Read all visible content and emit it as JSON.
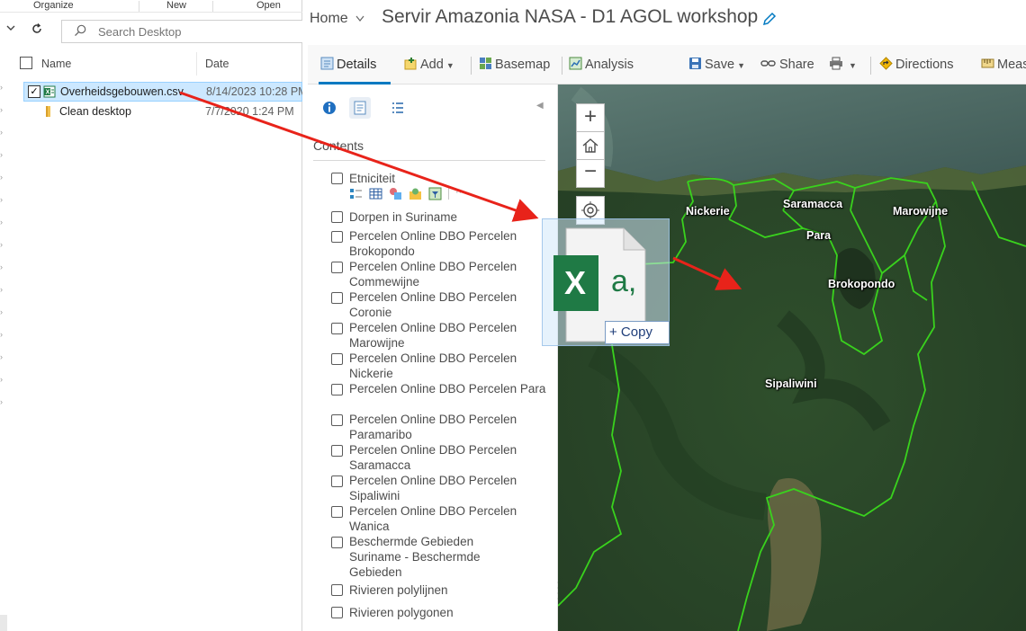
{
  "explorer": {
    "ribbon": [
      "Organize",
      "New",
      "Open"
    ],
    "search": {
      "placeholder": "Search Desktop"
    },
    "columns": {
      "name": "Name",
      "date": "Date"
    },
    "files": [
      {
        "name": "Overheidsgebouwen.csv",
        "date": "8/14/2023 10:28 PM",
        "type": "excel-csv",
        "selected": true,
        "checked": true
      },
      {
        "name": "Clean desktop",
        "date": "7/7/2020 1:24 PM",
        "type": "shortcut",
        "selected": false,
        "checked": false
      }
    ]
  },
  "arcgis": {
    "home": "Home",
    "title": "Servir Amazonia NASA - D1 AGOL workshop",
    "toolbar": {
      "details": "Details",
      "add": "Add",
      "basemap": "Basemap",
      "analysis": "Analysis",
      "save": "Save",
      "share": "Share",
      "directions": "Directions",
      "measure": "Meas"
    },
    "contents_heading": "Contents",
    "layers": [
      "Etniciteit",
      "Dorpen in Suriname",
      "Percelen Online DBO Percelen Brokopondo",
      "Percelen Online DBO Percelen Commewijne",
      "Percelen Online DBO Percelen Coronie",
      "Percelen Online DBO Percelen Marowijne",
      "Percelen Online DBO Percelen Nickerie",
      "Percelen Online DBO Percelen Para",
      "Percelen Online DBO Percelen Paramaribo",
      "Percelen Online DBO Percelen Saramacca",
      "Percelen Online DBO Percelen Sipaliwini",
      "Percelen Online DBO Percelen Wanica",
      "Beschermde Gebieden Suriname - Beschermde Gebieden",
      "Rivieren polylijnen",
      "Rivieren polygonen"
    ],
    "map_labels": {
      "nickerie": "Nickerie",
      "saramacca": "Saramacca",
      "marowijne": "Marowijne",
      "para": "Para",
      "brokopondo": "Brokopondo",
      "sipaliwini": "Sipaliwini"
    }
  },
  "drag": {
    "copy_label": "+ Copy",
    "icon_glyph": "X",
    "icon_suffix": "a,"
  },
  "colors": {
    "accent": "#0079c1",
    "boundary": "#39d21d",
    "arrow": "#e8231a",
    "selection": "#cce8ff",
    "excel_green": "#1f7a45"
  },
  "icons": [
    "search-icon",
    "refresh-icon",
    "chevron-down-icon",
    "excel-file-icon",
    "folder-icon",
    "pencil-icon",
    "info-icon",
    "legend-icon",
    "list-icon",
    "home-icon",
    "locate-icon",
    "save-icon",
    "share-icon",
    "print-icon",
    "directions-icon"
  ]
}
